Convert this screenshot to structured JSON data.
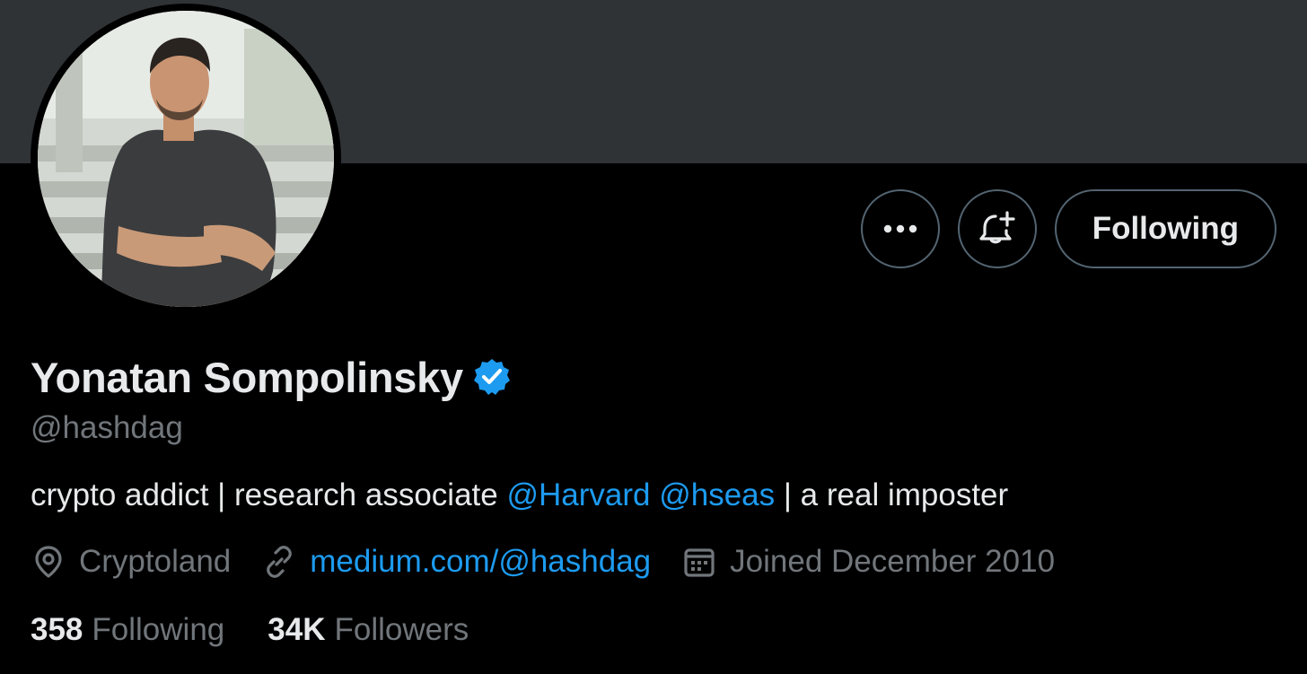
{
  "profile": {
    "display_name": "Yonatan Sompolinsky",
    "handle": "@hashdag",
    "bio": {
      "prefix": "crypto addict | research associate ",
      "mention_1": "@Harvard",
      "mention_2": "@hseas",
      "suffix": " | a real imposter"
    },
    "location": "Cryptoland",
    "website": "medium.com/@hashdag",
    "joined": "Joined December 2010"
  },
  "stats": {
    "following_count": "358",
    "following_label": "Following",
    "followers_count": "34K",
    "followers_label": "Followers"
  },
  "actions": {
    "follow_button_label": "Following",
    "more_icon": "more-horizontal-icon",
    "notify_icon": "bell-plus-icon"
  },
  "icons": {
    "verified": "verified-badge-icon",
    "location": "location-pin-icon",
    "link": "link-icon",
    "calendar": "calendar-icon"
  },
  "colors": {
    "background": "#000000",
    "banner": "#2f3336",
    "accent": "#1d9bf0",
    "primary_text": "#e7e9ea",
    "secondary_text": "#71767b"
  }
}
